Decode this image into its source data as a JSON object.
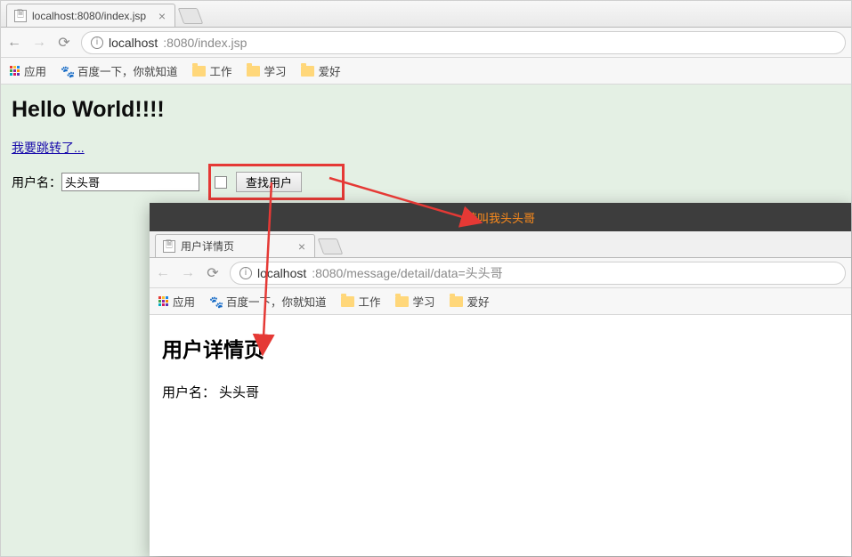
{
  "win1": {
    "tab_title": "localhost:8080/index.jsp",
    "url_host": "localhost",
    "url_port_path": ":8080/index.jsp",
    "bookmarks": {
      "apps": "应用",
      "baidu": "百度一下，你就知道",
      "work": "工作",
      "study": "学习",
      "hobby": "爱好"
    },
    "page": {
      "heading": "Hello World!!!!",
      "jump_link": "我要跳转了...",
      "label_username": "用户名：",
      "input_value": "头头哥",
      "btn_find": "查找用户"
    }
  },
  "win2": {
    "titlebar": "请叫我头头哥",
    "tab_title": "用户详情页",
    "url_host": "localhost",
    "url_port_path": ":8080/message/detail/data=头头哥",
    "bookmarks": {
      "apps": "应用",
      "baidu": "百度一下，你就知道",
      "work": "工作",
      "study": "学习",
      "hobby": "爱好"
    },
    "page": {
      "heading": "用户详情页",
      "label_username": "用户名：",
      "username_value": "头头哥"
    }
  },
  "annotation_color": "#e53935"
}
